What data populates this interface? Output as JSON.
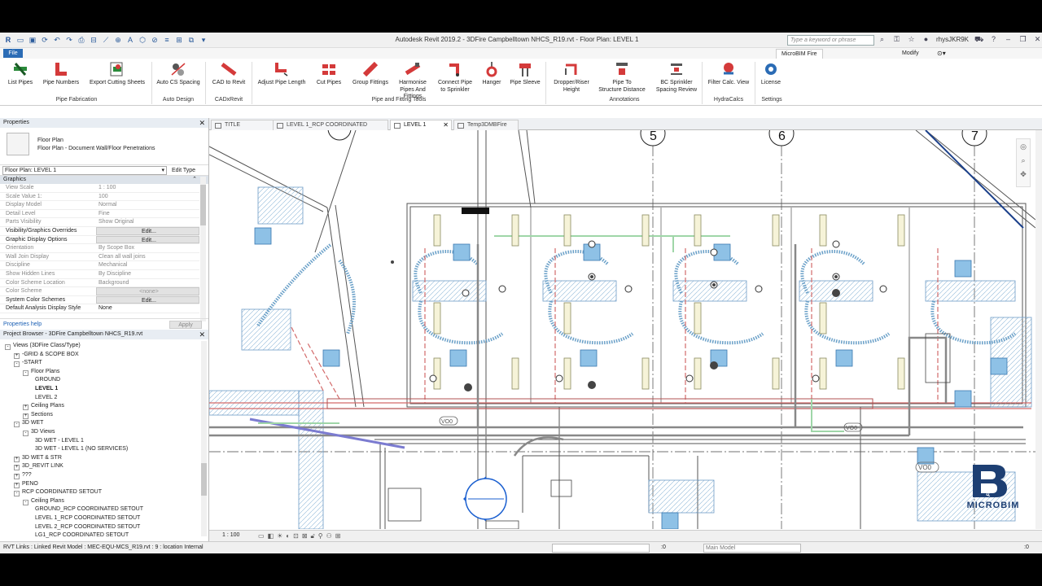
{
  "window": {
    "title": "Autodesk Revit 2019.2 - 3DFire Campbelltown NHCS_R19.rvt - Floor Plan: LEVEL 1",
    "search_placeholder": "Type a keyword or phrase",
    "user": "rhysJKR9K"
  },
  "ribbon_tabs": {
    "file": "File",
    "active": "MicroBIM Fire",
    "modify": "Modify"
  },
  "ribbon": {
    "buttons": [
      {
        "label": "List Pipes",
        "icon": "list-pipes-icon"
      },
      {
        "label": "Pipe Numbers",
        "icon": "pipe-numbers-icon"
      },
      {
        "label": "Export Cutting Sheets",
        "icon": "export-cutting-sheets-icon"
      },
      {
        "label": "Auto CS Spacing",
        "icon": "auto-cs-spacing-icon"
      },
      {
        "label": "CAD to Revit",
        "icon": "cad-to-revit-icon"
      },
      {
        "label": "Adjust Pipe Length",
        "icon": "adjust-pipe-length-icon"
      },
      {
        "label": "Cut Pipes",
        "icon": "cut-pipes-icon"
      },
      {
        "label": "Group Fittings",
        "icon": "group-fittings-icon"
      },
      {
        "label": "Harmonise\nPipes And\nFittings",
        "icon": "harmonise-icon"
      },
      {
        "label": "Connect Pipe\nto Sprinkler",
        "icon": "connect-pipe-icon"
      },
      {
        "label": "Hanger",
        "icon": "hanger-icon"
      },
      {
        "label": "Pipe Sleeve",
        "icon": "pipe-sleeve-icon"
      },
      {
        "label": "Dropper/Riser\nHeight",
        "icon": "dropper-riser-icon"
      },
      {
        "label": "Pipe To\nStructure Distance",
        "icon": "pipe-structure-icon"
      },
      {
        "label": "BC Sprinkler\nSpacing Review",
        "icon": "sprinkler-spacing-icon"
      },
      {
        "label": "Filter Calc. View",
        "icon": "filter-calc-icon"
      },
      {
        "label": "License",
        "icon": "license-icon"
      }
    ],
    "panels": [
      "Pipe Fabrication",
      "Auto Design",
      "CADxRevit",
      "Pipe and Fitting Tools",
      "Annotations",
      "HydraCalcs",
      "Settings"
    ]
  },
  "properties": {
    "header": "Properties",
    "type_name": "Floor Plan",
    "type_sub": "Floor Plan - Document Wall/Floor Penetrations",
    "selector": "Floor Plan: LEVEL 1",
    "edit_type": "Edit Type",
    "group": "Graphics",
    "rows": [
      {
        "k": "View Scale",
        "v": "1 : 100"
      },
      {
        "k": "Scale Value    1:",
        "v": "100"
      },
      {
        "k": "Display Model",
        "v": "Normal"
      },
      {
        "k": "Detail Level",
        "v": "Fine"
      },
      {
        "k": "Parts Visibility",
        "v": "Show Original"
      },
      {
        "k": "Visibility/Graphics Overrides",
        "v": "Edit..."
      },
      {
        "k": "Graphic Display Options",
        "v": "Edit..."
      },
      {
        "k": "Orientation",
        "v": "By Scope Box"
      },
      {
        "k": "Wall Join Display",
        "v": "Clean all wall joins"
      },
      {
        "k": "Discipline",
        "v": "Mechanical"
      },
      {
        "k": "Show Hidden Lines",
        "v": "By Discipline"
      },
      {
        "k": "Color Scheme Location",
        "v": "Background"
      },
      {
        "k": "Color Scheme",
        "v": "<none>"
      },
      {
        "k": "System Color Schemes",
        "v": "Edit..."
      },
      {
        "k": "Default Analysis Display Style",
        "v": "None"
      }
    ],
    "help": "Properties help",
    "apply": "Apply"
  },
  "browser": {
    "header": "Project Browser - 3DFire Campbelltown NHCS_R19.rvt",
    "items": [
      {
        "t": "Views (3DFire Class/Type)",
        "lvl": 0,
        "pm": "-"
      },
      {
        "t": "-GRID & SCOPE BOX",
        "lvl": 1,
        "pm": "+"
      },
      {
        "t": "-START",
        "lvl": 1,
        "pm": "-"
      },
      {
        "t": "Floor Plans",
        "lvl": 2,
        "pm": "-"
      },
      {
        "t": "GROUND",
        "lvl": 3,
        "pm": ""
      },
      {
        "t": "LEVEL 1",
        "lvl": 3,
        "pm": "",
        "bold": true
      },
      {
        "t": "LEVEL 2",
        "lvl": 3,
        "pm": ""
      },
      {
        "t": "Ceiling Plans",
        "lvl": 2,
        "pm": "+"
      },
      {
        "t": "Sections",
        "lvl": 2,
        "pm": "+"
      },
      {
        "t": "3D WET",
        "lvl": 1,
        "pm": "-"
      },
      {
        "t": "3D Views",
        "lvl": 2,
        "pm": "-"
      },
      {
        "t": "3D WET - LEVEL 1",
        "lvl": 3,
        "pm": ""
      },
      {
        "t": "3D WET - LEVEL 1 (NO SERVICES)",
        "lvl": 3,
        "pm": ""
      },
      {
        "t": "3D WET & STR",
        "lvl": 1,
        "pm": "+"
      },
      {
        "t": "3D_REVIT LINK",
        "lvl": 1,
        "pm": "+"
      },
      {
        "t": "???",
        "lvl": 1,
        "pm": "+"
      },
      {
        "t": "PENO",
        "lvl": 1,
        "pm": "+"
      },
      {
        "t": "RCP COORDINATED SETOUT",
        "lvl": 1,
        "pm": "-"
      },
      {
        "t": "Ceiling Plans",
        "lvl": 2,
        "pm": "-"
      },
      {
        "t": "GROUND_RCP COORDINATED SETOUT",
        "lvl": 3,
        "pm": ""
      },
      {
        "t": "LEVEL 1_RCP COORDINATED SETOUT",
        "lvl": 3,
        "pm": ""
      },
      {
        "t": "LEVEL 2_RCP COORDINATED SETOUT",
        "lvl": 3,
        "pm": ""
      },
      {
        "t": "LG1_RCP COORDINATED SETOUT",
        "lvl": 3,
        "pm": ""
      }
    ]
  },
  "view_tabs": [
    {
      "label": "TITLE",
      "active": false
    },
    {
      "label": "LEVEL 1_RCP COORDINATED SETOUT",
      "active": false
    },
    {
      "label": "LEVEL 1",
      "active": true
    },
    {
      "label": "Temp3DMBFire",
      "active": false
    }
  ],
  "drawing": {
    "grid_labels": [
      "5",
      "6",
      "7"
    ],
    "tag_text": "VO0"
  },
  "view_control": {
    "scale": "1 : 100"
  },
  "status": {
    "text": "RVT Links : Linked Revit Model : MEC-EQU-MCS_R19.rvt : 9 : location Internal",
    "coord": ":0",
    "model": "Main Model",
    "filter": ":0"
  },
  "watermark": {
    "brand": "MICROBIM",
    "sub": "FIRE"
  }
}
